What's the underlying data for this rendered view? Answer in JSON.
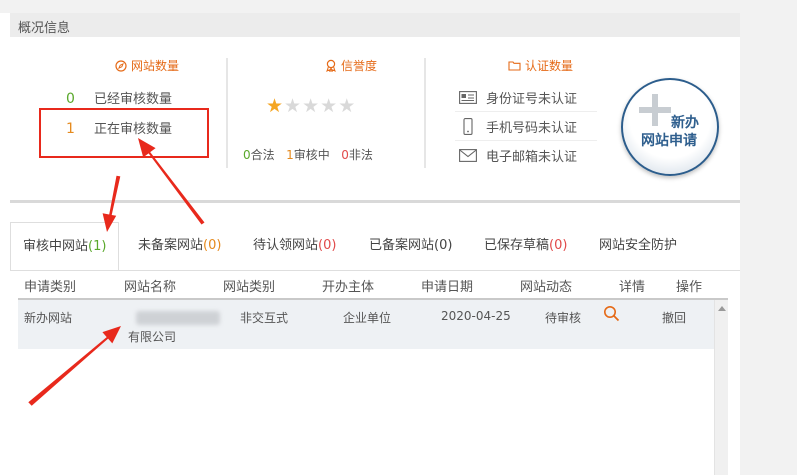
{
  "header": {
    "title": "概况信息"
  },
  "site_count": {
    "title": "网站数量",
    "approved": {
      "count": "0",
      "label": "已经审核数量"
    },
    "reviewing": {
      "count": "1",
      "label": "正在审核数量"
    }
  },
  "credit": {
    "title": "信誉度",
    "stars_filled": 1,
    "stars_total": 5,
    "legal_count": "0",
    "legal_label": "合法",
    "reviewing_count": "1",
    "reviewing_label": "审核中",
    "illegal_count": "0",
    "illegal_label": "非法"
  },
  "cert": {
    "title": "认证数量",
    "items": [
      {
        "label": "身份证号未认证",
        "icon": "id-card-icon"
      },
      {
        "label": "手机号码未认证",
        "icon": "mobile-phone-icon"
      },
      {
        "label": "电子邮箱未认证",
        "icon": "envelope-icon"
      }
    ]
  },
  "new_site_button": {
    "line1": "新办",
    "line2": "网站申请"
  },
  "tabs": [
    {
      "label": "审核中网站",
      "count": "(1)",
      "count_color": "#5aa82b"
    },
    {
      "label": "未备案网站",
      "count": "(0)",
      "count_color": "#e58a1e"
    },
    {
      "label": "待认领网站",
      "count": "(0)",
      "count_color": "#e14a4a"
    },
    {
      "label": "已备案网站",
      "count": "(0)",
      "count_color": "#444444"
    },
    {
      "label": "已保存草稿",
      "count": "(0)",
      "count_color": "#e14a4a"
    },
    {
      "label": "网站安全防护",
      "count": "",
      "count_color": "#444444"
    }
  ],
  "table": {
    "columns": [
      "申请类别",
      "网站名称",
      "网站类别",
      "开办主体",
      "申请日期",
      "网站动态",
      "详情",
      "操作"
    ],
    "rows": [
      {
        "type": "新办网站",
        "name_suffix": "有限公司",
        "category": "非交互式",
        "entity": "企业单位",
        "date": "2020-04-25",
        "status": "待审核",
        "action": "撤回"
      }
    ]
  },
  "colors": {
    "accent": "#e56a17",
    "annotation": "#e8291c",
    "button_border": "#2c5d8c"
  }
}
